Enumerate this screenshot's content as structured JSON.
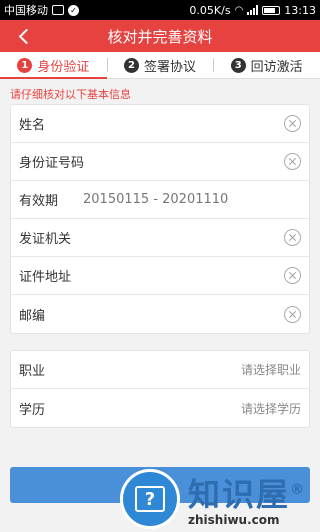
{
  "status_bar": {
    "carrier": "中国移动",
    "speed": "0.05K/s",
    "time": "13:13"
  },
  "nav": {
    "title": "核对并完善资料"
  },
  "steps": [
    {
      "num": "1",
      "label": "身份验证",
      "active": true
    },
    {
      "num": "2",
      "label": "签署协议",
      "active": false
    },
    {
      "num": "3",
      "label": "回访激活",
      "active": false
    }
  ],
  "hint": "请仔细核对以下基本信息",
  "identity": {
    "name_label": "姓名",
    "id_label": "身份证号码",
    "validity_label": "有效期",
    "validity_value": "20150115 - 20201110",
    "issuer_label": "发证机关",
    "address_label": "证件地址",
    "zip_label": "邮编"
  },
  "extra": {
    "job_label": "职业",
    "job_placeholder": "请选择职业",
    "edu_label": "学历",
    "edu_placeholder": "请选择学历"
  },
  "watermark": {
    "cn": "知识屋",
    "mark": "®",
    "en": "zhishiwu.com"
  },
  "colors": {
    "brand": "#e64340",
    "button": "#4a90d9"
  }
}
